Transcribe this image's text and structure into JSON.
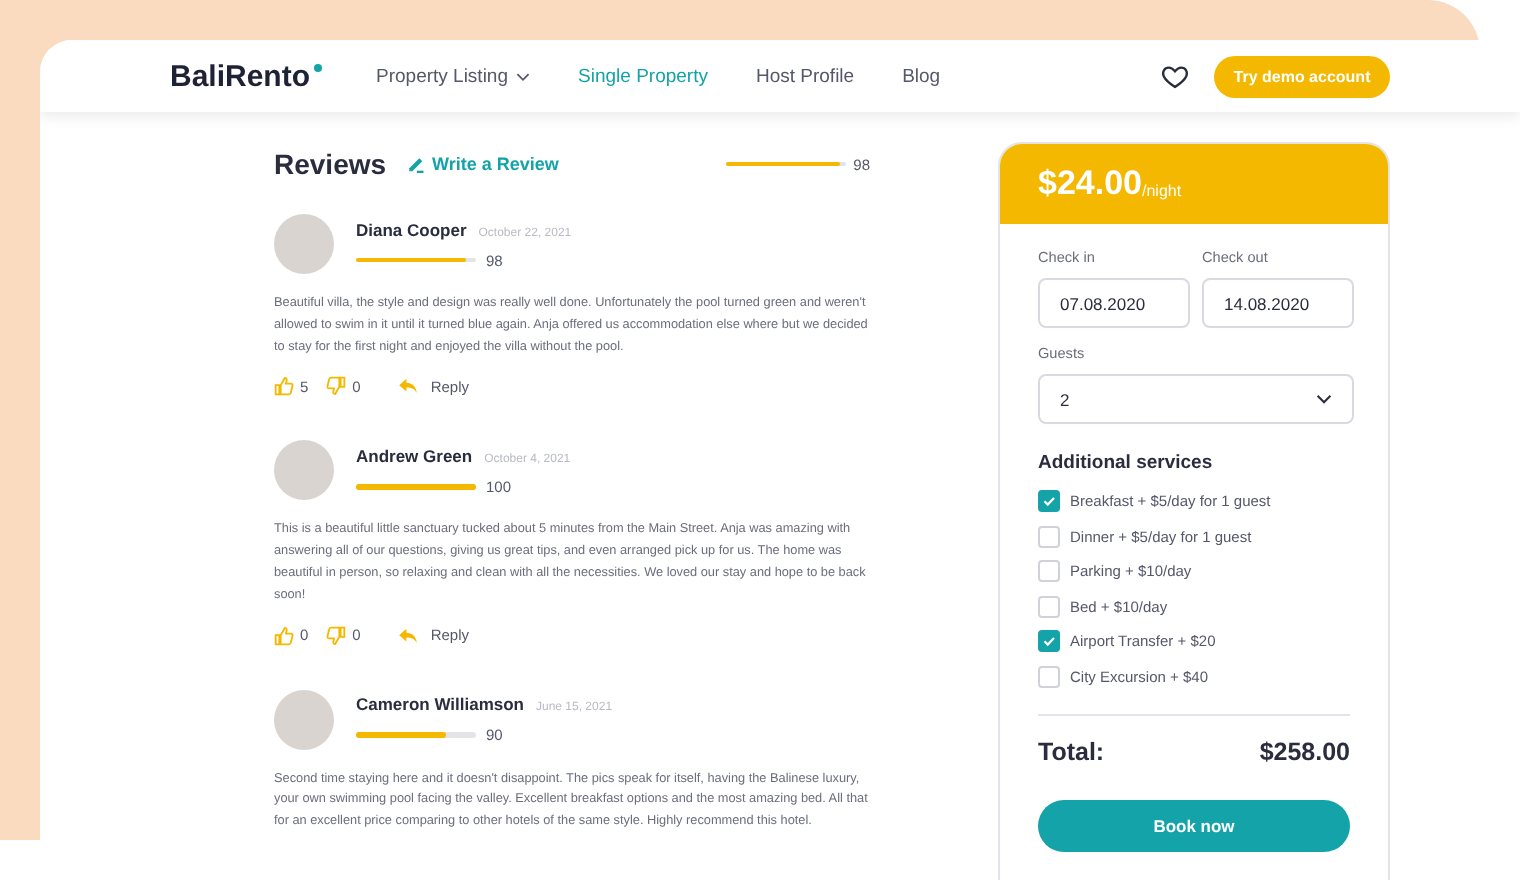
{
  "header": {
    "logo": "BaliRento",
    "nav": [
      {
        "label": "Property Listing",
        "selected": false,
        "dropdown": true
      },
      {
        "label": "Single Property",
        "selected": true,
        "dropdown": false
      },
      {
        "label": "Host Profile",
        "selected": false,
        "dropdown": false
      },
      {
        "label": "Blog",
        "selected": false,
        "dropdown": false
      }
    ],
    "cta": "Try demo account"
  },
  "reviews": {
    "title": "Reviews",
    "write_link": "Write a Review",
    "overall": {
      "level": 0.95,
      "score": "98"
    },
    "items": [
      {
        "name": "Diana Cooper",
        "date": "October 22, 2021",
        "level": 0.92,
        "score": "98",
        "text": "Beautiful villa, the style and design was really well done. Unfortunately the pool turned green and weren't allowed to swim in it until it turned blue again. Anja offered us accommodation else where but we decided to stay for the first night and enjoyed the villa without the pool.",
        "likes": "5",
        "dislikes": "0",
        "reply": "Reply"
      },
      {
        "name": "Andrew Green",
        "date": "October 4, 2021",
        "level": 1,
        "score": "100",
        "text": "This is a beautiful little sanctuary tucked about 5 minutes from the Main Street. Anja was amazing with answering all of our questions, giving us great tips, and even arranged pick up for us. The home was beautiful in person, so relaxing and clean with all the necessities. We loved our stay and hope to be back soon!",
        "likes": "0",
        "dislikes": "0",
        "reply": "Reply"
      },
      {
        "name": "Cameron Williamson",
        "date": "June 15, 2021",
        "level": 0.75,
        "score": "90",
        "text": "Second time staying here and it doesn't disappoint. The pics speak for itself, having the Balinese luxury, your own swimming pool facing the valley. Excellent breakfast options and the most amazing bed. All that for an excellent price comparing to other hotels of the same style. Highly recommend this hotel."
      }
    ]
  },
  "booking": {
    "price": "$24.00",
    "unit": "/night",
    "check_in": {
      "label": "Check in",
      "value": "07.08.2020"
    },
    "check_out": {
      "label": "Check out",
      "value": "14.08.2020"
    },
    "guests": {
      "label": "Guests",
      "value": "2"
    },
    "services_title": "Additional services",
    "services": [
      {
        "label": "Breakfast + $5/day for 1 guest",
        "checked": true
      },
      {
        "label": "Dinner + $5/day for 1 guest",
        "checked": false
      },
      {
        "label": "Parking + $10/day",
        "checked": false
      },
      {
        "label": "Bed + $10/day",
        "checked": false
      },
      {
        "label": "Airport Transfer + $20",
        "checked": true
      },
      {
        "label": "City Excursion + $40",
        "checked": false
      }
    ],
    "total_label": "Total:",
    "total": "$258.00",
    "book_button": "Book now"
  }
}
